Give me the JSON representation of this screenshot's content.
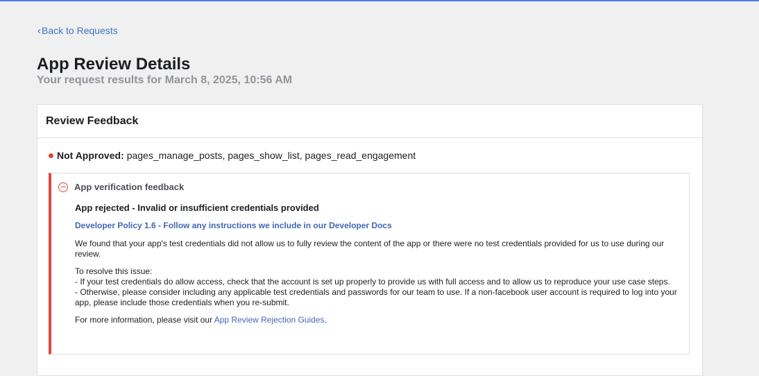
{
  "nav": {
    "back_label": "Back to Requests"
  },
  "page": {
    "title": "App Review Details",
    "subtitle": "Your request results for March 8, 2025, 10:56 AM"
  },
  "review": {
    "header": "Review Feedback",
    "status_label": "Not Approved:",
    "permissions": "pages_manage_posts, pages_show_list, pages_read_engagement",
    "status_color": "#e0483b",
    "feedback": {
      "section_title": "App verification feedback",
      "rejection_title": "App rejected - Invalid or insufficient credentials provided",
      "policy_link": "Developer Policy 1.6 - Follow any instructions we include in our Developer Docs",
      "explanation": "We found that your app's test credentials did not allow us to fully review the content of the app or there were no test credentials provided for us to use during our review.",
      "resolve": "To resolve this issue:\n- If your test credentials do allow access, check that the account is set up properly to provide us with full access and to allow us to reproduce your use case steps.\n- Otherwise, please consider including any applicable test credentials and passwords for our team to use. If a non-facebook user account is required to log into your app, please include those credentials when you re-submit.",
      "more_info_prefix": "For more information, please visit our ",
      "more_info_link": "App Review Rejection Guides",
      "more_info_suffix": "."
    }
  }
}
